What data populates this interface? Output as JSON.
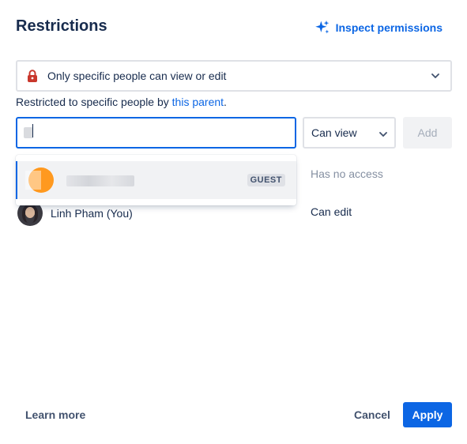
{
  "dialog": {
    "title": "Restrictions",
    "inspect_label": "Inspect permissions"
  },
  "restriction": {
    "selected": "Only specific people can view or edit",
    "note_prefix": "Restricted to specific people by ",
    "note_link": "this parent",
    "note_suffix": "."
  },
  "invite": {
    "search_value": "",
    "permission": "Can view",
    "add_label": "Add"
  },
  "dropdown": {
    "badge": "GUEST"
  },
  "rows": [
    {
      "access": "Has no access"
    },
    {
      "name": "Linh Pham (You)",
      "access": "Can edit"
    }
  ],
  "footer": {
    "learn_more": "Learn more",
    "cancel": "Cancel",
    "apply": "Apply"
  },
  "colors": {
    "accent": "#0c66e4",
    "lock_icon": "#c9372c",
    "guest_avatar": "#ff991f"
  },
  "icons": {
    "inspect": "sparkle-icon",
    "restriction": "lock-icon",
    "dropdown": "chevron-down-icon"
  }
}
